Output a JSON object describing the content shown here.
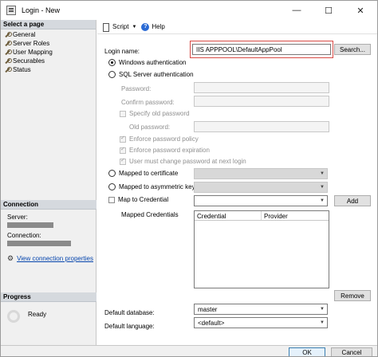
{
  "window": {
    "title": "Login - New",
    "minimize": "—",
    "maximize": "☐",
    "close": "✕"
  },
  "left": {
    "select_page": "Select a page",
    "pages": [
      "General",
      "Server Roles",
      "User Mapping",
      "Securables",
      "Status"
    ],
    "connection_header": "Connection",
    "server_label": "Server:",
    "connection_label": "Connection:",
    "view_connection": "View connection properties",
    "progress_header": "Progress",
    "ready": "Ready"
  },
  "toolbar": {
    "script": "Script",
    "help": "Help"
  },
  "form": {
    "login_name_label": "Login name:",
    "login_name_value": "IIS APPPOOL\\DefaultAppPool",
    "search_button": "Search...",
    "windows_auth": "Windows authentication",
    "sql_auth": "SQL Server authentication",
    "password": "Password:",
    "confirm_password": "Confirm password:",
    "specify_old": "Specify old password",
    "old_password": "Old password:",
    "enforce_policy": "Enforce password policy",
    "enforce_expiration": "Enforce password expiration",
    "must_change": "User must change password at next login",
    "mapped_cert": "Mapped to certificate",
    "mapped_asym": "Mapped to asymmetric key",
    "map_credential": "Map to Credential",
    "add_button": "Add",
    "mapped_credentials": "Mapped Credentials",
    "grid_headers": [
      "Credential",
      "Provider"
    ],
    "remove_button": "Remove",
    "default_database_label": "Default database:",
    "default_database_value": "master",
    "default_language_label": "Default language:",
    "default_language_value": "<default>"
  },
  "footer": {
    "ok": "OK",
    "cancel": "Cancel"
  }
}
